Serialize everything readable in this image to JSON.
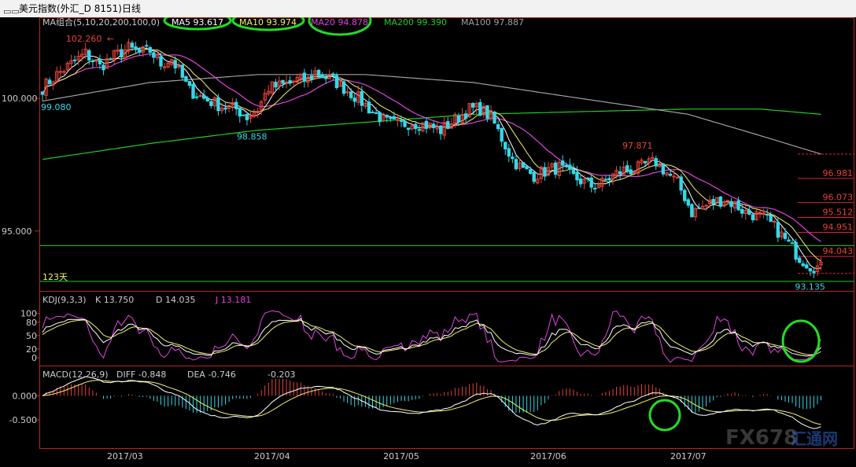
{
  "window": {
    "title": "美元指数(外汇_D 8151)日线"
  },
  "colors": {
    "up": "#e8433a",
    "down": "#35d8e8",
    "ma5": "#ffffff",
    "ma10": "#f2f26a",
    "ma20": "#e043e0",
    "ma200": "#22cc22",
    "ma100": "#a0a0a0",
    "axis": "#cc2222",
    "text": "#cccccc",
    "highlight": "#22dd22",
    "k": "#ffffff",
    "d": "#f2f26a",
    "j": "#e043e0",
    "diff": "#ffffff",
    "dea": "#f2f26a"
  },
  "chart_data": [
    {
      "type": "candlestick",
      "title": "MA组合(5,10,20,200,100,0)",
      "legend": [
        {
          "name": "MA5",
          "value": "93.617",
          "color": "#ffffff"
        },
        {
          "name": "MA10",
          "value": "93.974",
          "color": "#f2f26a"
        },
        {
          "name": "MA20",
          "value": "94.878",
          "color": "#e043e0"
        },
        {
          "name": "MA200",
          "value": "99.390",
          "color": "#22cc22"
        },
        {
          "name": "MA100",
          "value": "97.887",
          "color": "#a0a0a0"
        }
      ],
      "ylim": [
        92.8,
        103.0
      ],
      "yticks": [
        {
          "value": 100,
          "label": "100.000"
        },
        {
          "value": 95,
          "label": "95.000"
        }
      ],
      "xticks": [
        {
          "index": 23,
          "label": "2017/03"
        },
        {
          "index": 64,
          "label": "2017/04"
        },
        {
          "index": 100,
          "label": "2017/05"
        },
        {
          "index": 141,
          "label": "2017/06"
        },
        {
          "index": 180,
          "label": "2017/07"
        }
      ],
      "annotations": [
        {
          "index": 23,
          "value": 102.26,
          "label": "102.260"
        },
        {
          "index": 0,
          "value": 99.85,
          "label": "99.080"
        },
        {
          "index": 59,
          "value": 98.858,
          "label": "98.858"
        },
        {
          "index": 166,
          "value": 97.871,
          "label": "97.871"
        },
        {
          "index": 215,
          "value": 93.135,
          "label": "93.135"
        },
        {
          "index": 0,
          "value": 93.1,
          "label": "123天"
        }
      ],
      "price_levels": [
        {
          "value": 97.9,
          "label": ""
        },
        {
          "value": 96.981,
          "label": "96.981"
        },
        {
          "value": 96.073,
          "label": "96.073"
        },
        {
          "value": 95.512,
          "label": "95.512"
        },
        {
          "value": 94.951,
          "label": "94.951"
        },
        {
          "value": 94.043,
          "label": "94.043"
        },
        {
          "value": 93.4,
          "label": ""
        }
      ],
      "hlines": [
        94.45,
        93.1
      ],
      "anchors": [
        [
          0,
          100.4
        ],
        [
          4,
          100.9
        ],
        [
          8,
          101.3
        ],
        [
          12,
          101.7
        ],
        [
          16,
          101.2
        ],
        [
          20,
          101.6
        ],
        [
          24,
          101.9
        ],
        [
          27,
          101.7
        ],
        [
          30,
          101.8
        ],
        [
          33,
          101.3
        ],
        [
          36,
          101.5
        ],
        [
          38,
          101.0
        ],
        [
          41,
          100.3
        ],
        [
          45,
          100.0
        ],
        [
          50,
          99.7
        ],
        [
          54,
          99.6
        ],
        [
          57,
          99.3
        ],
        [
          60,
          99.6
        ],
        [
          63,
          100.4
        ],
        [
          67,
          100.5
        ],
        [
          71,
          100.7
        ],
        [
          74,
          100.7
        ],
        [
          76,
          101.0
        ],
        [
          79,
          100.8
        ],
        [
          82,
          100.6
        ],
        [
          85,
          100.3
        ],
        [
          88,
          100.0
        ],
        [
          92,
          99.5
        ],
        [
          96,
          99.1
        ],
        [
          99,
          99.0
        ],
        [
          103,
          99.1
        ],
        [
          107,
          99.0
        ],
        [
          111,
          98.8
        ],
        [
          115,
          99.2
        ],
        [
          119,
          99.6
        ],
        [
          122,
          99.6
        ],
        [
          125,
          99.3
        ],
        [
          128,
          98.5
        ],
        [
          131,
          97.7
        ],
        [
          134,
          97.3
        ],
        [
          137,
          97.1
        ],
        [
          141,
          97.3
        ],
        [
          144,
          97.4
        ],
        [
          147,
          97.1
        ],
        [
          150,
          96.9
        ],
        [
          153,
          96.7
        ],
        [
          156,
          96.8
        ],
        [
          159,
          97.1
        ],
        [
          162,
          97.3
        ],
        [
          165,
          97.3
        ],
        [
          168,
          97.5
        ],
        [
          171,
          97.6
        ],
        [
          174,
          97.2
        ],
        [
          177,
          96.8
        ],
        [
          179,
          96.3
        ],
        [
          181,
          95.7
        ],
        [
          184,
          95.9
        ],
        [
          187,
          96.1
        ],
        [
          190,
          96.2
        ],
        [
          193,
          96.0
        ],
        [
          196,
          95.7
        ],
        [
          199,
          95.6
        ],
        [
          202,
          95.4
        ],
        [
          205,
          95.0
        ],
        [
          208,
          94.5
        ],
        [
          211,
          94.0
        ],
        [
          214,
          93.7
        ],
        [
          217,
          93.6
        ]
      ],
      "ma200_anchors": [
        [
          0,
          97.7
        ],
        [
          30,
          98.3
        ],
        [
          60,
          98.8
        ],
        [
          90,
          99.1
        ],
        [
          120,
          99.4
        ],
        [
          150,
          99.5
        ],
        [
          180,
          99.6
        ],
        [
          200,
          99.6
        ],
        [
          217,
          99.4
        ]
      ],
      "ma100_anchors": [
        [
          0,
          99.9
        ],
        [
          30,
          100.6
        ],
        [
          60,
          100.9
        ],
        [
          90,
          100.9
        ],
        [
          120,
          100.6
        ],
        [
          150,
          100.0
        ],
        [
          180,
          99.4
        ],
        [
          200,
          98.6
        ],
        [
          217,
          97.9
        ]
      ]
    },
    {
      "type": "line",
      "title": "KDJ(9,3,3)",
      "legend": [
        {
          "name": "K",
          "value": "13.750",
          "color": "#ffffff"
        },
        {
          "name": "D",
          "value": "14.035",
          "color": "#f2f26a"
        },
        {
          "name": "J",
          "value": "13.181",
          "color": "#e043e0"
        }
      ],
      "ylim": [
        -12,
        108
      ],
      "yticks": [
        {
          "value": 100,
          "label": "100"
        },
        {
          "value": 80,
          "label": "80"
        },
        {
          "value": 50,
          "label": "50"
        },
        {
          "value": 20,
          "label": "20"
        },
        {
          "value": 0,
          "label": "0"
        }
      ]
    },
    {
      "type": "bar",
      "title": "MACD(12,26,9)",
      "legend": [
        {
          "name": "DIFF",
          "value": "-0.848",
          "color": "#ffffff"
        },
        {
          "name": "DEA",
          "value": "-0.746",
          "color": "#f2f26a"
        },
        {
          "name": "",
          "value": "-0.203",
          "color": "#ffffff"
        }
      ],
      "ylim": [
        -1.05,
        0.25
      ],
      "yticks": [
        {
          "value": 0,
          "label": "0.000"
        },
        {
          "value": -0.5,
          "label": "-0.500"
        }
      ]
    }
  ],
  "watermark": {
    "text": "FX678",
    "sub": "汇通网"
  }
}
